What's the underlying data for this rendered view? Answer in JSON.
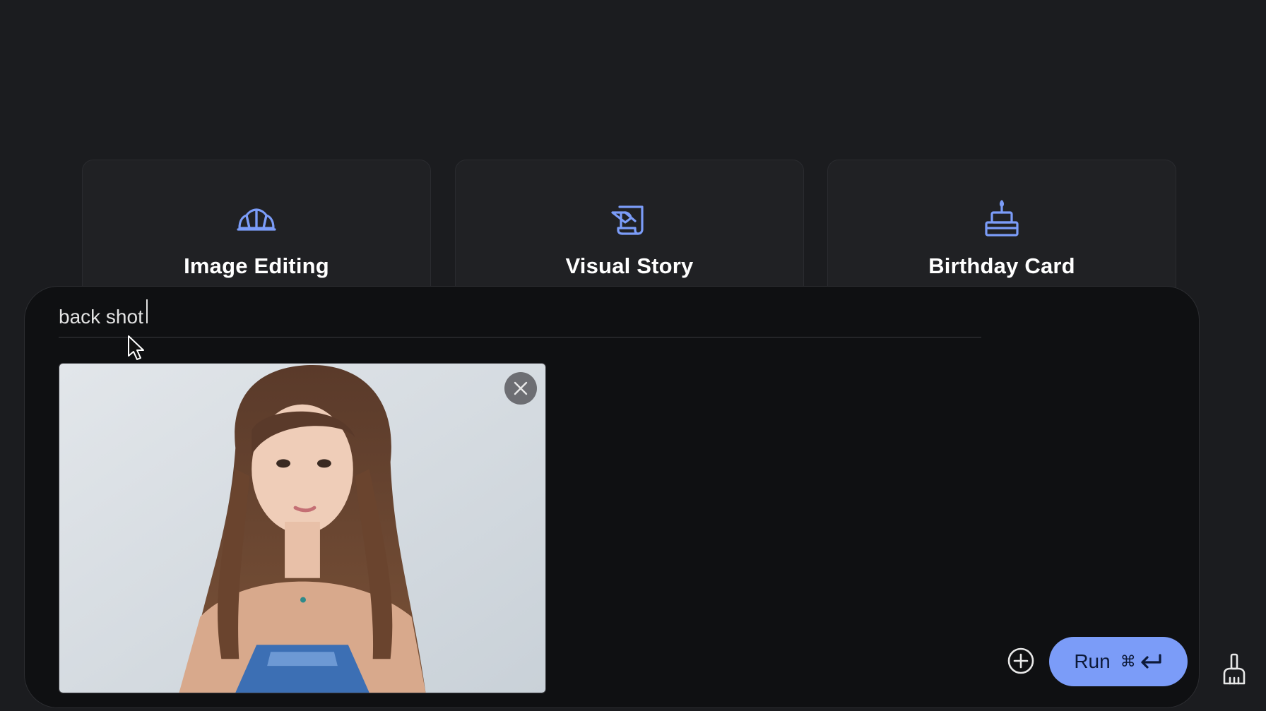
{
  "cards": [
    {
      "title": "Image Editing",
      "icon": "croissant-icon"
    },
    {
      "title": "Visual Story",
      "icon": "scroll-quill-icon"
    },
    {
      "title": "Birthday Card",
      "icon": "birthday-cake-icon"
    }
  ],
  "prompt": {
    "value": "back shot"
  },
  "attachment": {
    "remove_icon": "close-icon"
  },
  "actions": {
    "add_icon": "add-circle-icon",
    "run_label": "Run",
    "run_shortcut_symbol": "⌘",
    "run_shortcut_icon": "enter-key-icon",
    "clear_icon": "broom-icon"
  },
  "colors": {
    "background": "#1b1c1f",
    "card": "#202124",
    "panel": "#0f1012",
    "accent": "#7b9cf8",
    "icon_accent": "#8ab4f8"
  }
}
